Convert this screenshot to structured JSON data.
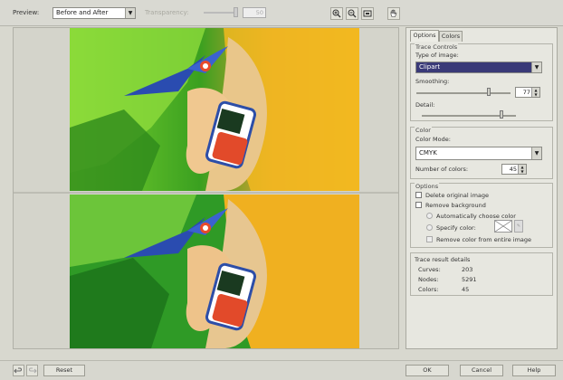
{
  "toolbar": {
    "preview_label": "Preview:",
    "preview_mode": "Before and After",
    "transparency_label": "Transparency:",
    "transparency_value": "50"
  },
  "tabs": [
    {
      "label": "Options"
    },
    {
      "label": "Colors"
    }
  ],
  "trace_controls": {
    "title": "Trace Controls",
    "type_of_image_label": "Type of image:",
    "type_of_image_value": "Clipart",
    "smoothing_label": "Smoothing:",
    "smoothing_value": "77",
    "smoothing_fraction": 0.77,
    "detail_label": "Detail:",
    "detail_fraction": 0.85
  },
  "color": {
    "title": "Color",
    "color_mode_label": "Color Mode:",
    "color_mode_value": "CMYK",
    "number_of_colors_label": "Number of colors:",
    "number_of_colors_value": "45"
  },
  "options": {
    "title": "Options",
    "delete_original": "Delete original image",
    "remove_background": "Remove background",
    "auto_choose_color": "Automatically choose color",
    "specify_color": "Specify color:",
    "remove_entire_image": "Remove color from entire image"
  },
  "trace_result": {
    "title": "Trace result details",
    "curves_label": "Curves:",
    "curves_value": "203",
    "nodes_label": "Nodes:",
    "nodes_value": "5291",
    "colors_label": "Colors:",
    "colors_value": "45"
  },
  "footer": {
    "reset_label": "Reset",
    "ok_label": "OK",
    "cancel_label": "Cancel",
    "help_label": "Help"
  },
  "colors": {
    "selected_highlight": "#3a3a78",
    "panel_bg": "#e7e7e0"
  }
}
